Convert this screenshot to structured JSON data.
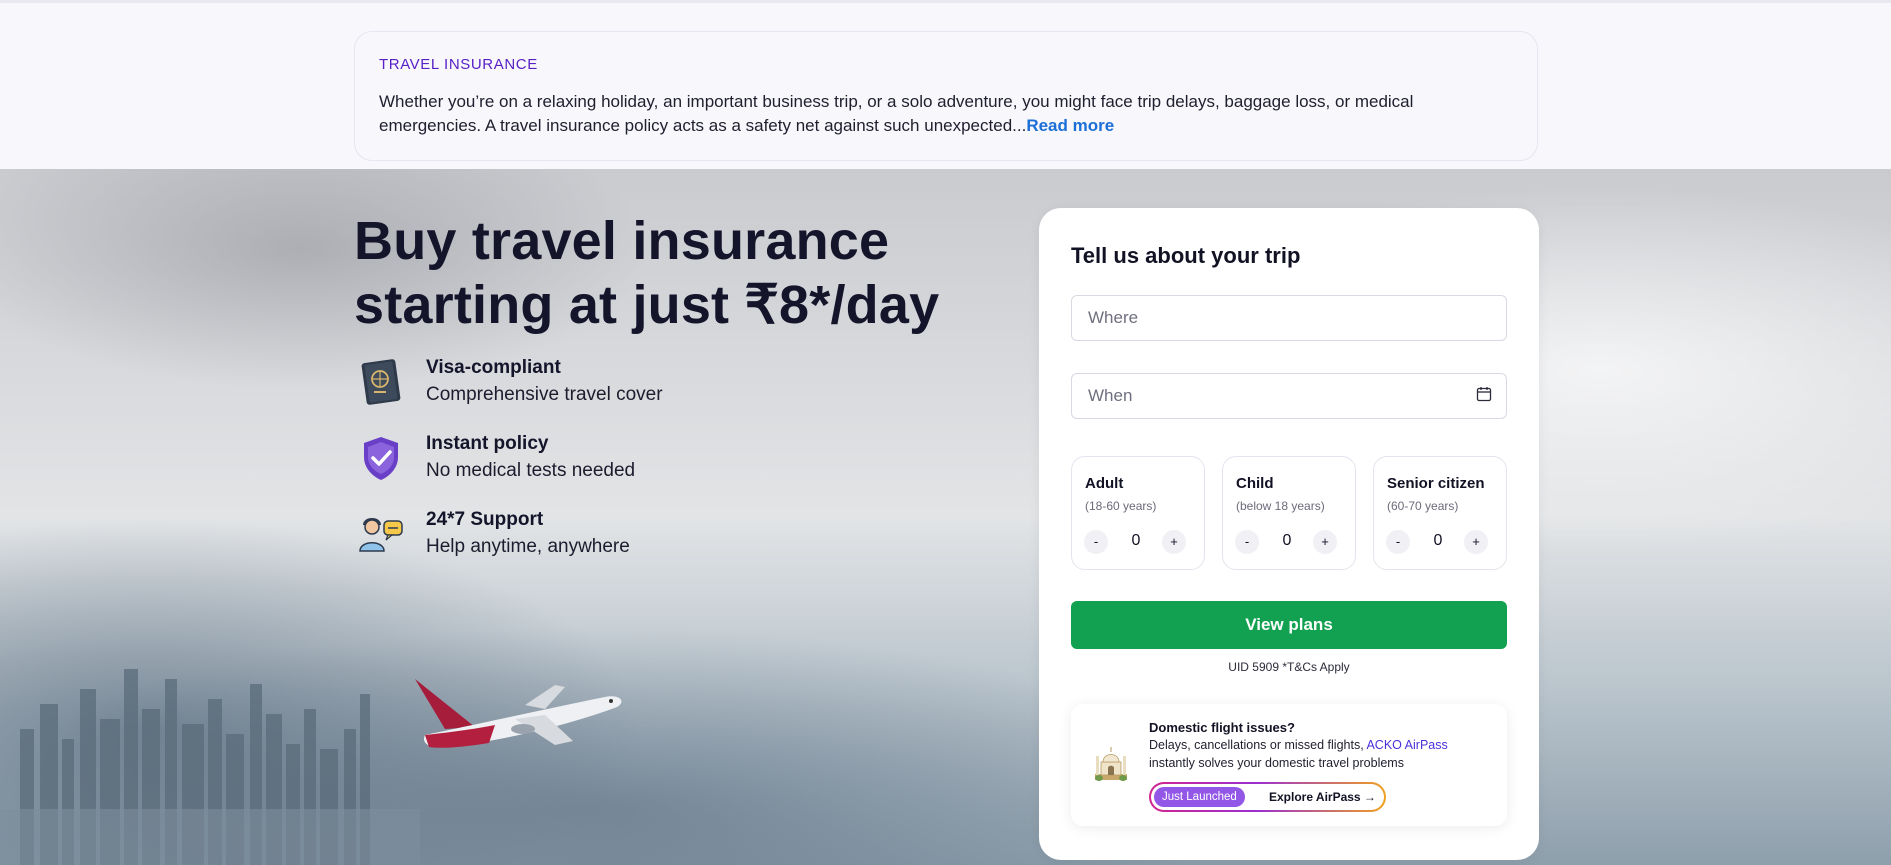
{
  "info": {
    "tag": "TRAVEL INSURANCE",
    "text": "Whether you’re on a relaxing holiday, an important business trip, or a solo adventure, you might face trip delays, baggage loss, or medical emergencies. A travel insurance policy acts as a safety net against such unexpected...",
    "read_more": "Read more"
  },
  "hero": {
    "headline_line1": "Buy travel insurance",
    "headline_line2": "starting at just ₹8*/day",
    "features": [
      {
        "icon": "passport-icon",
        "title": "Visa-compliant",
        "subtitle": "Comprehensive travel cover"
      },
      {
        "icon": "shield-check-icon",
        "title": "Instant policy",
        "subtitle": "No medical tests needed"
      },
      {
        "icon": "support-agent-icon",
        "title": "24*7 Support",
        "subtitle": "Help anytime, anywhere"
      }
    ]
  },
  "form": {
    "title": "Tell us about your trip",
    "where_placeholder": "Where",
    "when_placeholder": "When",
    "travellers": [
      {
        "label": "Adult",
        "range": "(18-60 years)",
        "count": "0",
        "minus": "-",
        "plus": "+"
      },
      {
        "label": "Child",
        "range": "(below 18 years)",
        "count": "0",
        "minus": "-",
        "plus": "+"
      },
      {
        "label": "Senior citizen",
        "range": "(60-70 years)",
        "count": "0",
        "minus": "-",
        "plus": "+"
      }
    ],
    "submit_label": "View plans",
    "disclaimer": "UID 5909 *T&Cs Apply"
  },
  "promo": {
    "title": "Domestic flight issues?",
    "line1_prefix": "Delays, cancellations or missed flights, ",
    "line1_link": "ACKO AirPass",
    "line2": "instantly solves your domestic travel problems",
    "badge": "Just Launched",
    "cta": "Explore AirPass →"
  },
  "colors": {
    "accent_purple": "#5920c5",
    "link_blue": "#1b6fd6",
    "cta_green": "#12a150",
    "headline": "#14142b"
  }
}
